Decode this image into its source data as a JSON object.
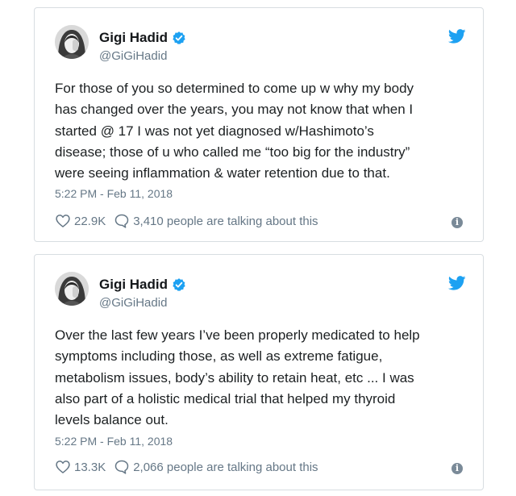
{
  "tweets": [
    {
      "author_name": "Gigi Hadid",
      "handle": "@GiGiHadid",
      "text": "For those of you so determined to come up w why my body\nhas changed over the years, you may not know that when I\nstarted @ 17 I was not yet diagnosed w/Hashimoto’s\ndisease; those of u who called me “too big for the industry”\nwere seeing inflammation & water retention due to that.",
      "timestamp": "5:22 PM - Feb 11, 2018",
      "likes": "22.9K",
      "talking": "3,410 people are talking about this",
      "info_glyph": "i"
    },
    {
      "author_name": "Gigi Hadid",
      "handle": "@GiGiHadid",
      "text": "Over the last few years I’ve been properly medicated to help\nsymptoms including those, as well as extreme fatigue,\nmetabolism issues, body’s ability to retain heat, etc ... I was\nalso part of a holistic medical trial that helped my thyroid\nlevels balance out.",
      "timestamp": "5:22 PM - Feb 11, 2018",
      "likes": "13.3K",
      "talking": "2,066 people are talking about this",
      "info_glyph": "i"
    }
  ],
  "icons": {
    "verified": "verified-badge-icon",
    "brand": "twitter-bird-icon",
    "like": "heart-icon",
    "reply": "speech-bubble-icon",
    "info": "info-icon"
  },
  "colors": {
    "brand_blue": "#1da1f2",
    "text": "#1c2022",
    "secondary_text": "#657786",
    "border": "#d8dde1",
    "info_bg": "#7a8a98"
  }
}
